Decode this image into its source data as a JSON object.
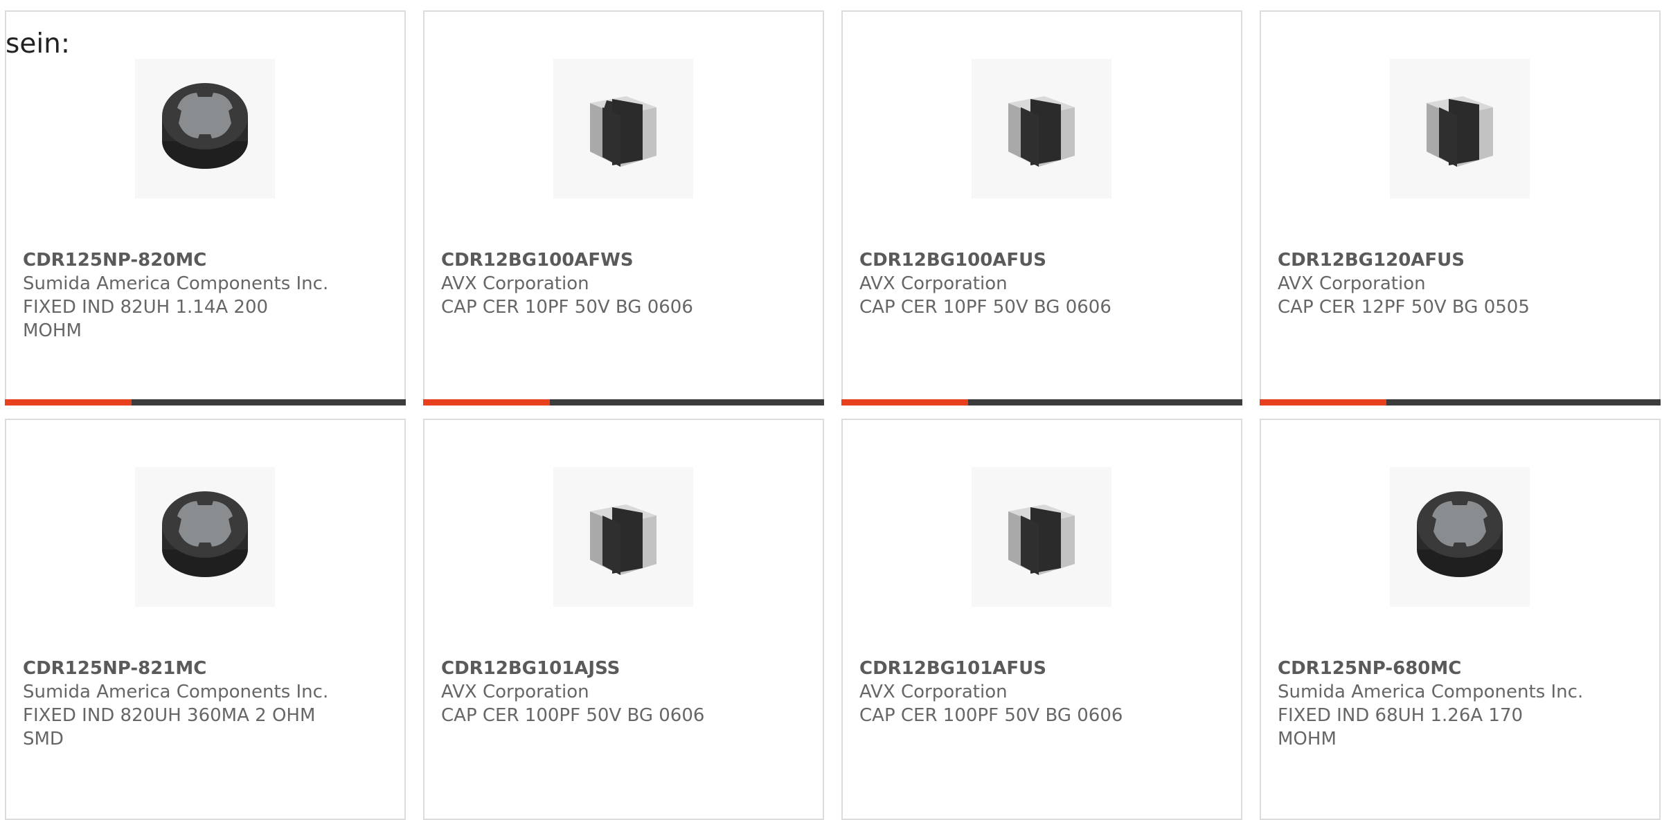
{
  "prefix_text": "sein:",
  "colors": {
    "accent": "#e8401c",
    "bar": "#3c3c3c",
    "border": "#dcdcdc",
    "text": "#666666"
  },
  "products": [
    {
      "part": "CDR125NP-820MC",
      "maker": "Sumida America Components Inc.",
      "desc": [
        "FIXED IND 82UH 1.14A 200",
        "MOHM"
      ],
      "image": "inductor-icon"
    },
    {
      "part": "CDR12BG100AFWS",
      "maker": "AVX Corporation",
      "desc": [
        "CAP CER 10PF 50V BG 0606",
        ""
      ],
      "image": "capacitor-icon"
    },
    {
      "part": "CDR12BG100AFUS",
      "maker": "AVX Corporation",
      "desc": [
        "CAP CER 10PF 50V BG 0606",
        ""
      ],
      "image": "capacitor-icon"
    },
    {
      "part": "CDR12BG120AFUS",
      "maker": "AVX Corporation",
      "desc": [
        "CAP CER 12PF 50V BG 0505",
        ""
      ],
      "image": "capacitor-icon"
    },
    {
      "part": "CDR125NP-821MC",
      "maker": "Sumida America Components Inc.",
      "desc": [
        "FIXED IND 820UH 360MA 2 OHM",
        "SMD"
      ],
      "image": "inductor-icon"
    },
    {
      "part": "CDR12BG101AJSS",
      "maker": "AVX Corporation",
      "desc": [
        "CAP CER 100PF 50V BG 0606",
        ""
      ],
      "image": "capacitor-icon"
    },
    {
      "part": "CDR12BG101AFUS",
      "maker": "AVX Corporation",
      "desc": [
        "CAP CER 100PF 50V BG 0606",
        ""
      ],
      "image": "capacitor-icon"
    },
    {
      "part": "CDR125NP-680MC",
      "maker": "Sumida America Components Inc.",
      "desc": [
        "FIXED IND 68UH 1.26A 170",
        "MOHM"
      ],
      "image": "inductor-icon"
    }
  ]
}
